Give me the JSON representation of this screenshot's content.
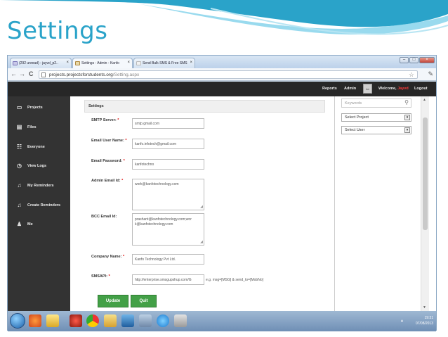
{
  "slide": {
    "title": "Settings"
  },
  "browser": {
    "tabs": [
      {
        "label": "(292 unread) - jayvd_p2..",
        "active": false
      },
      {
        "label": "Settings - Admin - Kanfo",
        "active": true
      },
      {
        "label": "Send Bulk SMS & Free SMS",
        "active": false
      }
    ],
    "address_domain": "projects.projectsforstudents.org",
    "address_path": "/Setting.aspx",
    "nav": {
      "back": "←",
      "forward": "→",
      "reload": "C"
    }
  },
  "topnav": {
    "reports": "Reports",
    "admin": "Admin",
    "avatar_text": "kw",
    "welcome": "Welcome,",
    "user": "Jayvd",
    "logout": "Logout"
  },
  "sidebar": {
    "items": [
      {
        "label": "Projects",
        "icon": "monitor-icon"
      },
      {
        "label": "Files",
        "icon": "files-icon"
      },
      {
        "label": "Everyone",
        "icon": "people-icon"
      },
      {
        "label": "View Logs",
        "icon": "clock-icon"
      },
      {
        "label": "My Reminders",
        "icon": "bell-icon"
      },
      {
        "label": "Create Reminders",
        "icon": "bell-icon"
      },
      {
        "label": "Me",
        "icon": "person-icon"
      }
    ]
  },
  "main": {
    "heading": "Settings",
    "form": {
      "smtp_server": {
        "label": "SMTP Server:",
        "value": "smtp.gmail.com"
      },
      "email_user": {
        "label": "Email User Name:",
        "value": "kanfo.infotech@gmail.com"
      },
      "email_password": {
        "label": "Email Password:",
        "value": "kanfotechno"
      },
      "admin_email": {
        "label": "Admin Email Id:",
        "value": "work@kanfotechnology.com"
      },
      "bcc_email": {
        "label": "BCC Email Id:",
        "value_line1": "prashant@kanfotechnology.com;wor",
        "value_line2": "k@kanfotechnology.com"
      },
      "company_name": {
        "label": "Company Name:",
        "value": "Kanfo Technology Pvt Ltd."
      },
      "smsapi": {
        "label": "SMSAPI:",
        "value": "http://enterprise.smsgupshup.com/G",
        "hint": "e.g. msg=[MSG] & send_to=[MobNo]"
      },
      "required_mark": "*"
    },
    "buttons": {
      "update": "Update",
      "quit": "Quit"
    }
  },
  "right_panel": {
    "keywords_placeholder": "Keywords",
    "select_project": "Select Project",
    "select_user": "Select User"
  },
  "taskbar": {
    "time": "19:31",
    "date": "07/08/2013"
  }
}
